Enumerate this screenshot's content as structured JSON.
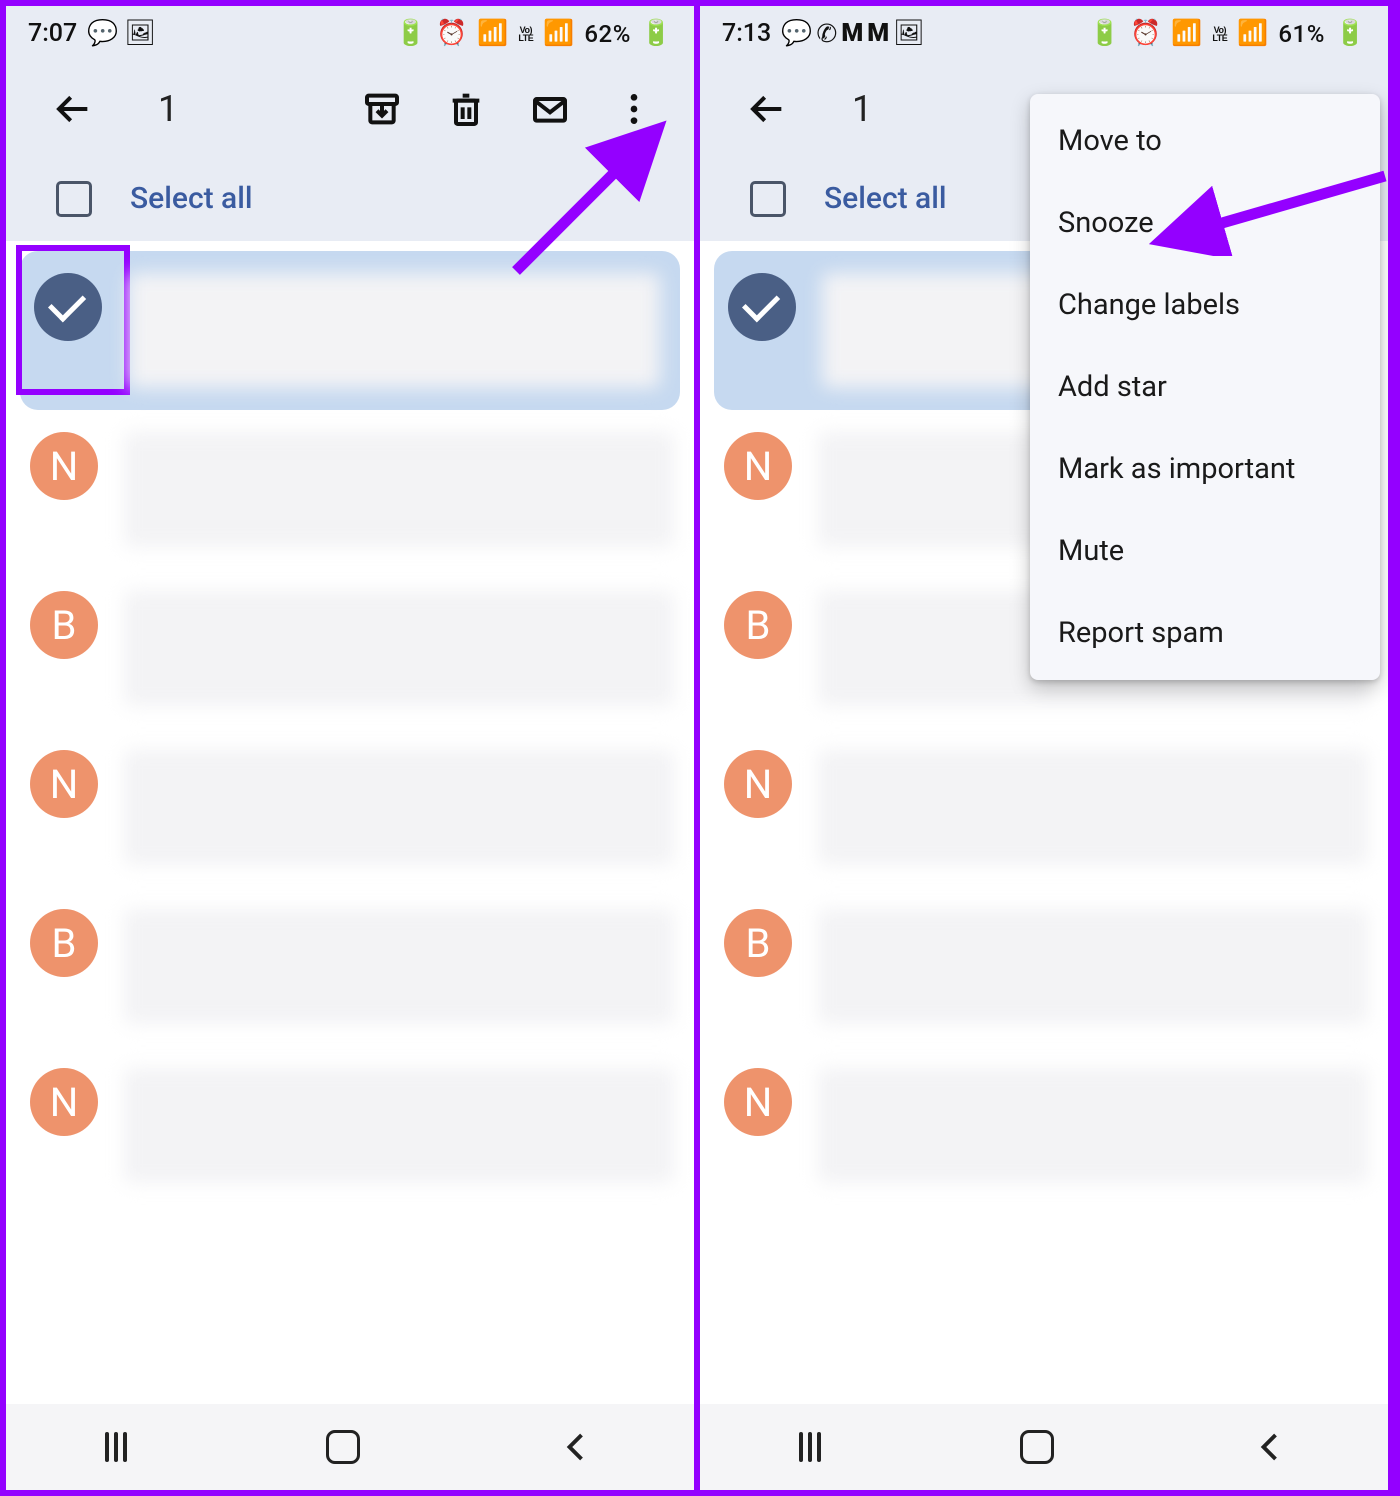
{
  "left": {
    "statusbar": {
      "time": "7:07",
      "battery": "62%"
    },
    "toolbar": {
      "selected_count": "1"
    },
    "select_all_label": "Select all",
    "emails": [
      {
        "selected": true,
        "avatar_letter": ""
      },
      {
        "selected": false,
        "avatar_letter": "N"
      },
      {
        "selected": false,
        "avatar_letter": "B"
      },
      {
        "selected": false,
        "avatar_letter": "N"
      },
      {
        "selected": false,
        "avatar_letter": "B"
      },
      {
        "selected": false,
        "avatar_letter": "N"
      }
    ]
  },
  "right": {
    "statusbar": {
      "time": "7:13",
      "battery": "61%"
    },
    "toolbar": {
      "selected_count": "1"
    },
    "select_all_label": "Select all",
    "menu_items": [
      "Move to",
      "Snooze",
      "Change labels",
      "Add star",
      "Mark as important",
      "Mute",
      "Report spam"
    ],
    "emails": [
      {
        "selected": true,
        "avatar_letter": ""
      },
      {
        "selected": false,
        "avatar_letter": "N"
      },
      {
        "selected": false,
        "avatar_letter": "B"
      },
      {
        "selected": false,
        "avatar_letter": "N"
      },
      {
        "selected": false,
        "avatar_letter": "B"
      },
      {
        "selected": false,
        "avatar_letter": "N"
      }
    ]
  },
  "annotation": {
    "left_arrow_target": "more-options-button",
    "right_arrow_target": "menu-item-snooze"
  }
}
